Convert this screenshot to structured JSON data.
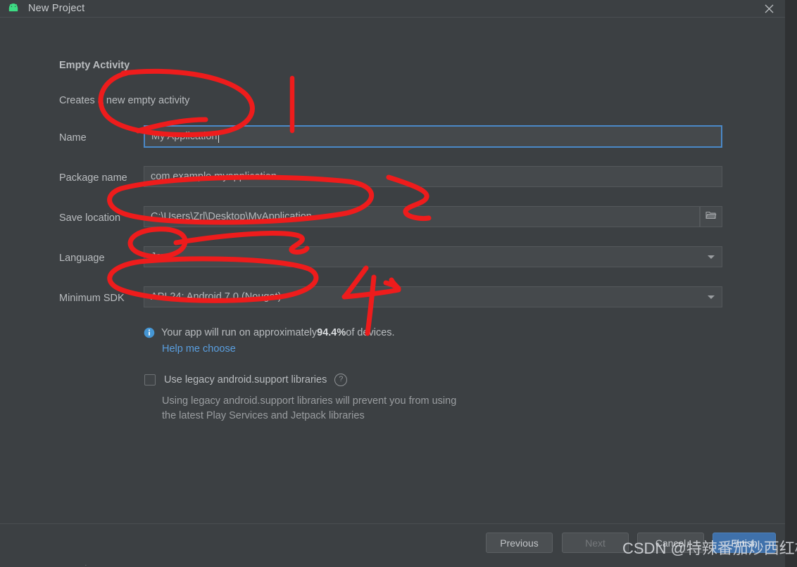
{
  "window": {
    "title": "New Project",
    "app_icon": "android-robot-icon",
    "close_icon": "close-icon"
  },
  "section": {
    "title": "Empty Activity",
    "description": "Creates a new empty activity"
  },
  "form": {
    "fields": [
      {
        "label": "Name",
        "value": "My Application",
        "kind": "text",
        "focused": true,
        "name": "name-field"
      },
      {
        "label": "Package name",
        "value": "com.example.myapplication",
        "kind": "text",
        "focused": false,
        "name": "package-name-field"
      },
      {
        "label": "Save location",
        "value": "C:\\Users\\Zrl\\Desktop\\MyApplication",
        "kind": "path",
        "focused": false,
        "name": "save-location-field",
        "button_icon": "folder-icon"
      },
      {
        "label": "Language",
        "value": "Java",
        "kind": "select",
        "focused": false,
        "name": "language-select",
        "arrow_icon": "chevron-down-icon"
      },
      {
        "label": "Minimum SDK",
        "value": "API 24: Android 7.0 (Nougat)",
        "kind": "select",
        "focused": false,
        "name": "minimum-sdk-select",
        "arrow_icon": "chevron-down-icon"
      }
    ]
  },
  "sdk_info": {
    "icon": "info-icon",
    "text_before": "Your app will run on approximately ",
    "percentage": "94.4%",
    "text_after": " of devices.",
    "help_link": "Help me choose"
  },
  "legacy": {
    "checkbox_label": "Use legacy android.support libraries",
    "checked": false,
    "help_icon": "question-mark-icon",
    "help_icon_glyph": "?",
    "description_line1": "Using legacy android.support libraries will prevent you from using",
    "description_line2": "the latest Play Services and Jetpack libraries"
  },
  "footer": {
    "buttons": [
      {
        "label": "Previous",
        "name": "previous-button",
        "disabled": false,
        "primary": false
      },
      {
        "label": "Next",
        "name": "next-button",
        "disabled": true,
        "primary": false
      },
      {
        "label": "Cancel",
        "name": "cancel-button",
        "disabled": false,
        "primary": false
      },
      {
        "label": "Finish",
        "name": "finish-button",
        "disabled": false,
        "primary": true
      }
    ]
  },
  "watermark": {
    "text": "CSDN @特辣番茄炒西红柿"
  },
  "annotations": {
    "color": "#ee1c1c",
    "marks": [
      {
        "name": "circle-around-name-label",
        "shape": "ellipse"
      },
      {
        "name": "stroke-digit-one",
        "shape": "vertical-stroke"
      },
      {
        "name": "circle-around-save-location",
        "shape": "ellipse"
      },
      {
        "name": "arrow-two",
        "shape": "arrow"
      },
      {
        "name": "circle-around-language",
        "shape": "ellipse"
      },
      {
        "name": "arrow-three",
        "shape": "arrow"
      },
      {
        "name": "circle-around-minimum-sdk",
        "shape": "ellipse"
      },
      {
        "name": "stroke-digit-four",
        "shape": "digit-four"
      }
    ]
  },
  "colors": {
    "dialog_background": "#3c4043",
    "field_background": "#45494c",
    "focus_border": "#4a88c7",
    "primary_button": "#3f71ab",
    "link": "#5a9fe0",
    "android_green": "#3ddc84",
    "annotation_red": "#ee1c1c"
  }
}
